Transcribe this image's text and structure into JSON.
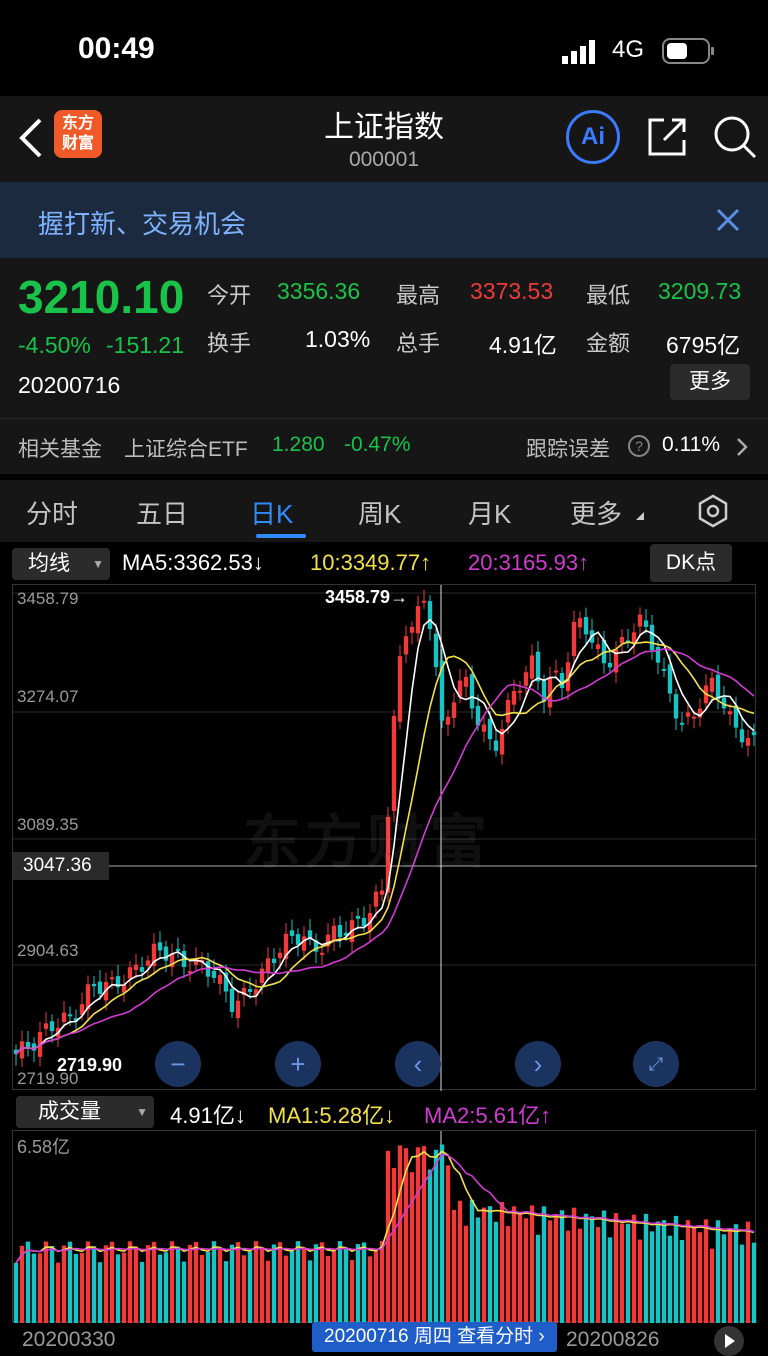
{
  "status": {
    "time": "00:49",
    "network": "4G"
  },
  "nav": {
    "title": "上证指数",
    "code": "000001",
    "logo_line1": "东方",
    "logo_line2": "财富",
    "ai_label": "Ai"
  },
  "banner": {
    "text": "握打新、交易机会"
  },
  "quote": {
    "price": "3210.10",
    "change_pct": "-4.50%",
    "change_abs": "-151.21",
    "date": "20200716",
    "open_label": "今开",
    "open": "3356.36",
    "high_label": "最高",
    "high": "3373.53",
    "low_label": "最低",
    "low": "3209.73",
    "turnover_label": "换手",
    "turnover": "1.03%",
    "volume_label": "总手",
    "volume": "4.91亿",
    "amount_label": "金额",
    "amount": "6795亿",
    "more_label": "更多"
  },
  "fund": {
    "label": "相关基金",
    "name": "上证综合ETF",
    "price": "1.280",
    "change": "-0.47%",
    "tracking_label": "跟踪误差",
    "tracking_value": "0.11%"
  },
  "tabs": [
    "分时",
    "五日",
    "日K",
    "周K",
    "月K",
    "更多"
  ],
  "active_tab": "日K",
  "ma_bar": {
    "select": "均线",
    "ma5": "MA5:3362.53↓",
    "ma10": "10:3349.77↑",
    "ma20": "20:3165.93↑",
    "dk": "DK点"
  },
  "price_axis": {
    "p1": "3458.79",
    "p2": "3274.07",
    "p3": "3089.35",
    "p4": "2904.63",
    "p5": "2719.90",
    "cross": "3047.36",
    "max_label": "3458.79→",
    "min_label": "2719.90"
  },
  "vol_bar": {
    "select": "成交量",
    "vol": "4.91亿↓",
    "ma1": "MA1:5.28亿↓",
    "ma2": "MA2:5.61亿↑"
  },
  "vol_axis": {
    "top": "6.58亿"
  },
  "date_axis": {
    "d1": "20200330",
    "tooltip": "20200716 周四 查看分时",
    "d3": "20200826"
  },
  "colors": {
    "up": "#f03a3a",
    "down": "#19c3c3",
    "ma5": "#ffffff",
    "ma10": "#f2e14b",
    "ma20": "#d23bd2",
    "accent": "#2f8cff"
  },
  "watermark": "东方财富"
}
